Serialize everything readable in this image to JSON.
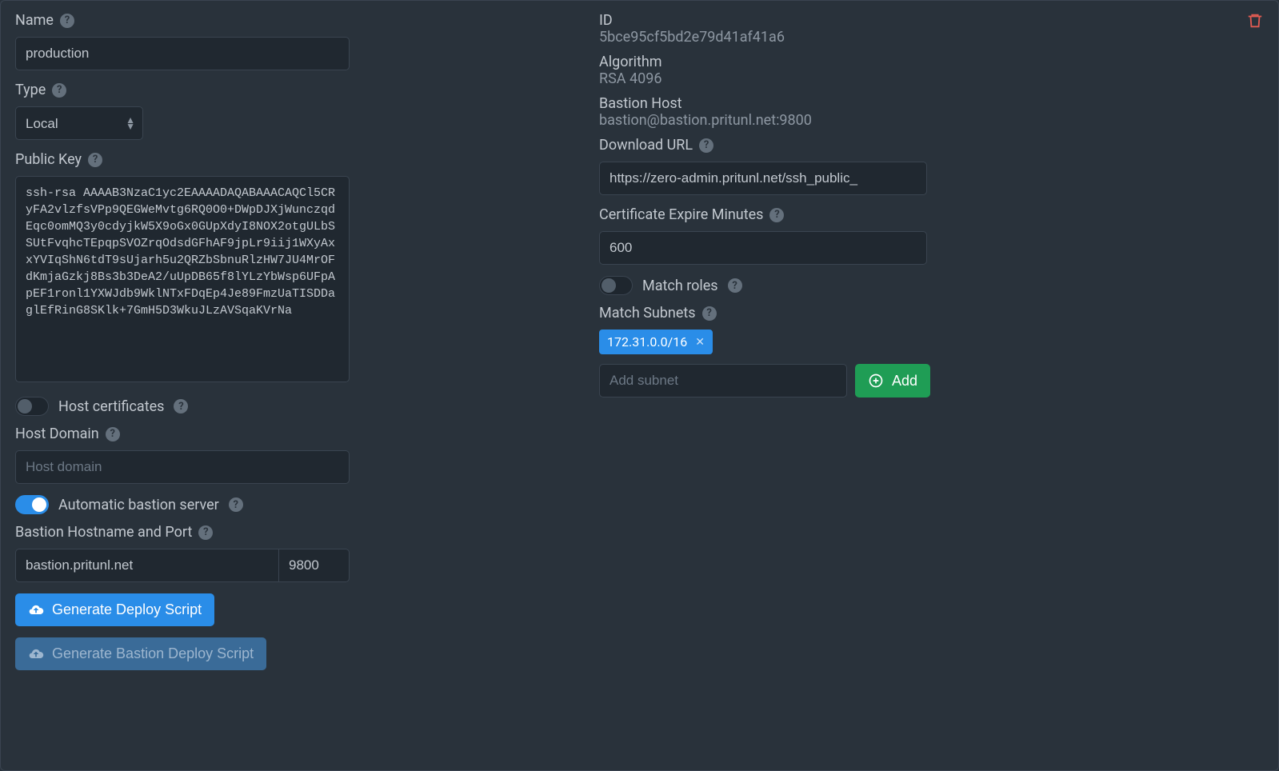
{
  "left": {
    "name_label": "Name",
    "name_value": "production",
    "type_label": "Type",
    "type_value": "Local",
    "pubkey_label": "Public Key",
    "pubkey_value": "ssh-rsa AAAAB3NzaC1yc2EAAAADAQABAAACAQCl5CRyFA2vlzfsVPp9QEGWeMvtg6RQ0O0+DWpDJXjWunczqdEqc0omMQ3y0cdyjkW5X9oGx0GUpXdyI8NOX2otgULbSSUtFvqhcTEpqpSVOZrqOdsdGFhAF9jpLr9iij1WXyAxxYVIqShN6tdT9sUjarh5u2QRZbSbnuRlzHW7JU4MrOFdKmjaGzkj8Bs3b3DeA2/uUpDB65f8lYLzYbWsp6UFpApEF1ronl1YXWJdb9WklNTxFDqEp4Je89FmzUaTISDDaglEfRinG8SKlk+7GmH5D3WkuJLzAVSqaKVrNa",
    "host_certs_label": "Host certificates",
    "host_domain_label": "Host Domain",
    "host_domain_placeholder": "Host domain",
    "auto_bastion_label": "Automatic bastion server",
    "bastion_label": "Bastion Hostname and Port",
    "bastion_host": "bastion.pritunl.net",
    "bastion_port": "9800",
    "btn_deploy": "Generate Deploy Script",
    "btn_bastion_deploy": "Generate Bastion Deploy Script"
  },
  "right": {
    "id_label": "ID",
    "id_value": "5bce95cf5bd2e79d41af41a6",
    "algo_label": "Algorithm",
    "algo_value": "RSA 4096",
    "bastion_host_label": "Bastion Host",
    "bastion_host_value": "bastion@bastion.pritunl.net:9800",
    "download_label": "Download URL",
    "download_value": "https://zero-admin.pritunl.net/ssh_public_",
    "expire_label": "Certificate Expire Minutes",
    "expire_value": "600",
    "match_roles_label": "Match roles",
    "match_subnets_label": "Match Subnets",
    "subnet_tag": "172.31.0.0/16",
    "subnet_placeholder": "Add subnet",
    "btn_add": "Add"
  }
}
